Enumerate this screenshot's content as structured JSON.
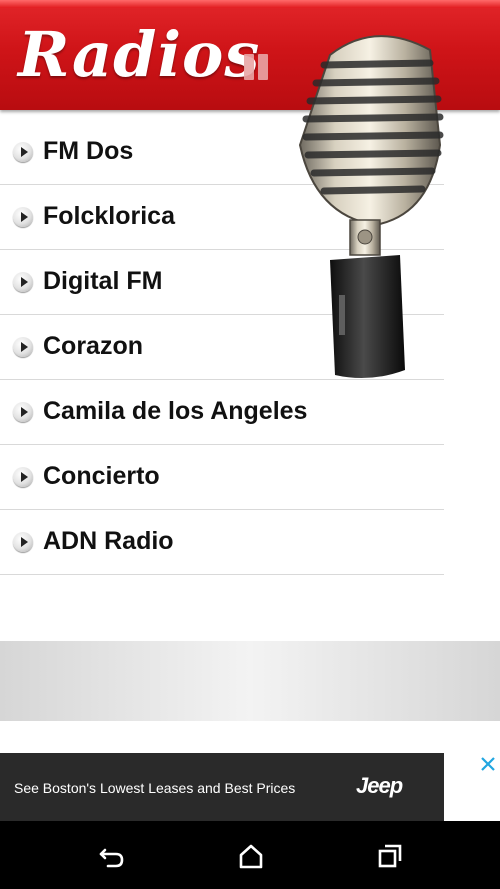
{
  "header": {
    "title": "Radios",
    "pause_icon": "pause-icon"
  },
  "stations": [
    {
      "name": "FM Dos"
    },
    {
      "name": "Folcklorica"
    },
    {
      "name": "Digital FM"
    },
    {
      "name": "Corazon"
    },
    {
      "name": "Camila de los Angeles"
    },
    {
      "name": "Concierto"
    },
    {
      "name": "ADN Radio"
    }
  ],
  "ad": {
    "text": "See Boston's Lowest Leases and Best Prices",
    "brand": "Jeep",
    "close_icon": "close-icon"
  },
  "navbar": {
    "back_icon": "back-icon",
    "home_icon": "home-icon",
    "recents_icon": "recents-icon"
  },
  "colors": {
    "header_red": "#cf1418",
    "text": "#111111",
    "ad_background": "#2a2a2a"
  }
}
